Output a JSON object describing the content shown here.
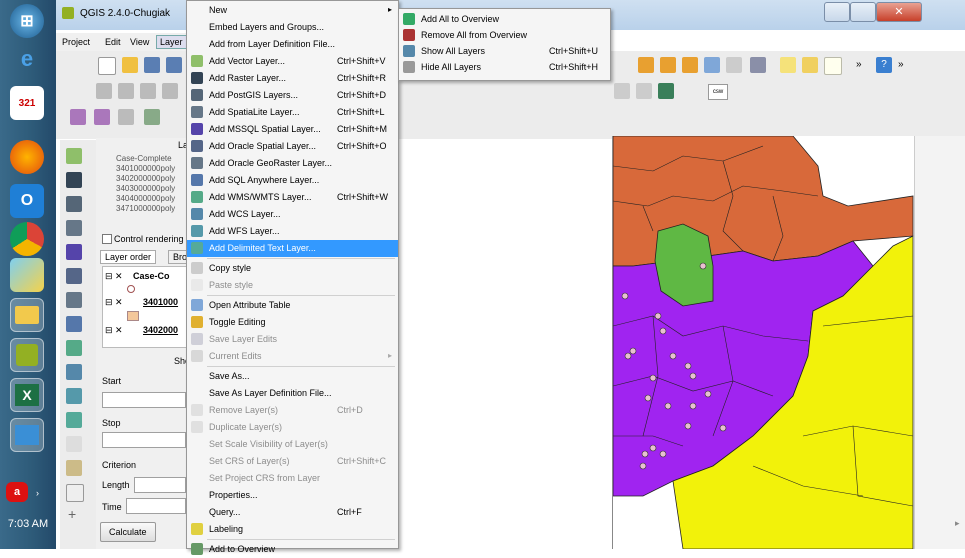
{
  "taskbar": {
    "clock": "7:03 AM",
    "icons": [
      "start-orb-icon",
      "ie-icon",
      "calendar-icon",
      "firefox-icon",
      "outlook-icon",
      "chrome-icon",
      "lync-icon",
      "file-explorer-icon",
      "qgis-icon",
      "excel-icon",
      "onenote-icon",
      "acrobat-icon"
    ],
    "calendar_day": "321"
  },
  "window": {
    "title": "QGIS 2.4.0-Chugiak"
  },
  "menubar": {
    "items": [
      "Project",
      "Edit",
      "View",
      "Layer"
    ]
  },
  "layer_menu": {
    "items": [
      {
        "label": "New",
        "shortcut": "",
        "submenu": true,
        "icon": "blank",
        "disabled": false
      },
      {
        "label": "Embed Layers and Groups...",
        "shortcut": "",
        "icon": "blank",
        "disabled": false
      },
      {
        "label": "Add from Layer Definition File...",
        "shortcut": "",
        "icon": "blank",
        "disabled": false
      },
      {
        "label": "Add Vector Layer...",
        "shortcut": "Ctrl+Shift+V",
        "icon": "vector",
        "disabled": false
      },
      {
        "label": "Add Raster Layer...",
        "shortcut": "Ctrl+Shift+R",
        "icon": "raster",
        "disabled": false
      },
      {
        "label": "Add PostGIS Layers...",
        "shortcut": "Ctrl+Shift+D",
        "icon": "postgis",
        "disabled": false
      },
      {
        "label": "Add SpatiaLite Layer...",
        "shortcut": "Ctrl+Shift+L",
        "icon": "spatialite",
        "disabled": false
      },
      {
        "label": "Add MSSQL Spatial Layer...",
        "shortcut": "Ctrl+Shift+M",
        "icon": "mssql",
        "disabled": false
      },
      {
        "label": "Add Oracle Spatial Layer...",
        "shortcut": "Ctrl+Shift+O",
        "icon": "oracle",
        "disabled": false
      },
      {
        "label": "Add Oracle GeoRaster Layer...",
        "shortcut": "",
        "icon": "georaster",
        "disabled": false
      },
      {
        "label": "Add SQL Anywhere Layer...",
        "shortcut": "",
        "icon": "sqlanywhere",
        "disabled": false
      },
      {
        "label": "Add WMS/WMTS Layer...",
        "shortcut": "Ctrl+Shift+W",
        "icon": "wms",
        "disabled": false
      },
      {
        "label": "Add WCS Layer...",
        "shortcut": "",
        "icon": "wcs",
        "disabled": false
      },
      {
        "label": "Add WFS Layer...",
        "shortcut": "",
        "icon": "wfs",
        "disabled": false
      },
      {
        "label": "Add Delimited Text Layer...",
        "shortcut": "",
        "icon": "delimited",
        "disabled": false,
        "highlighted": true
      },
      {
        "label": "Copy style",
        "shortcut": "",
        "icon": "copy",
        "disabled": false,
        "sep_before": true
      },
      {
        "label": "Paste style",
        "shortcut": "",
        "icon": "paste",
        "disabled": true
      },
      {
        "label": "Open Attribute Table",
        "shortcut": "",
        "icon": "table",
        "disabled": false,
        "sep_before": true
      },
      {
        "label": "Toggle Editing",
        "shortcut": "",
        "icon": "pencil",
        "disabled": false
      },
      {
        "label": "Save Layer Edits",
        "shortcut": "",
        "icon": "save",
        "disabled": true
      },
      {
        "label": "Current Edits",
        "shortcut": "",
        "submenu": true,
        "icon": "edits",
        "disabled": true
      },
      {
        "label": "Save As...",
        "shortcut": "",
        "icon": "blank",
        "disabled": false,
        "sep_before": true
      },
      {
        "label": "Save As Layer Definition File...",
        "shortcut": "",
        "icon": "blank",
        "disabled": false
      },
      {
        "label": "Remove Layer(s)",
        "shortcut": "Ctrl+D",
        "icon": "remove",
        "disabled": true
      },
      {
        "label": "Duplicate Layer(s)",
        "shortcut": "",
        "icon": "duplicate",
        "disabled": true
      },
      {
        "label": "Set Scale Visibility of Layer(s)",
        "shortcut": "",
        "icon": "blank",
        "disabled": true
      },
      {
        "label": "Set CRS of Layer(s)",
        "shortcut": "Ctrl+Shift+C",
        "icon": "blank",
        "disabled": true
      },
      {
        "label": "Set Project CRS from Layer",
        "shortcut": "",
        "icon": "blank",
        "disabled": true
      },
      {
        "label": "Properties...",
        "shortcut": "",
        "icon": "blank",
        "disabled": false
      },
      {
        "label": "Query...",
        "shortcut": "Ctrl+F",
        "icon": "blank",
        "disabled": false
      },
      {
        "label": "Labeling",
        "shortcut": "",
        "icon": "labeling",
        "disabled": false
      },
      {
        "label": "Add to Overview",
        "shortcut": "",
        "icon": "overview",
        "disabled": false,
        "sep_before": true
      }
    ]
  },
  "overview_menu": {
    "items": [
      {
        "label": "Add All to Overview",
        "shortcut": "",
        "icon": "overview-add"
      },
      {
        "label": "Remove All from Overview",
        "shortcut": "",
        "icon": "overview-remove"
      },
      {
        "label": "Show All Layers",
        "shortcut": "Ctrl+Shift+U",
        "icon": "eye"
      },
      {
        "label": "Hide All Layers",
        "shortcut": "Ctrl+Shift+H",
        "icon": "eye-closed"
      }
    ]
  },
  "panel": {
    "layers_header": "La",
    "layers": [
      "Case-Complete",
      "3401000000poly",
      "3402000000poly",
      "3403000000poly",
      "3404000000poly",
      "3471000000poly"
    ],
    "control_rendering": "Control rendering",
    "tab_layer_order": "Layer order",
    "tab_browser": "Bro",
    "tree": [
      "Case-Co",
      "3401000",
      "3402000"
    ],
    "section": "Sho",
    "start_label": "Start",
    "stop_label": "Stop",
    "criterion_label": "Criterion",
    "length_label": "Length",
    "time_label": "Time",
    "calculate_button": "Calculate"
  },
  "toolbar": {
    "csw_label": "csw"
  },
  "map": {
    "colors": {
      "orange": "#d8693a",
      "purple": "#a024f0",
      "green": "#5fb844",
      "yellow": "#f2f20a"
    }
  }
}
